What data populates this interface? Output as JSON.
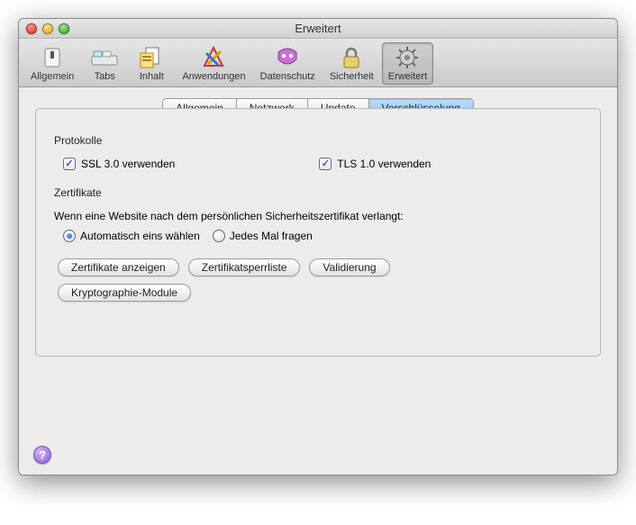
{
  "window": {
    "title": "Erweitert"
  },
  "toolbar": {
    "items": [
      {
        "name": "allgemein",
        "label": "Allgemein",
        "selected": false
      },
      {
        "name": "tabs",
        "label": "Tabs",
        "selected": false
      },
      {
        "name": "inhalt",
        "label": "Inhalt",
        "selected": false
      },
      {
        "name": "anwendungen",
        "label": "Anwendungen",
        "selected": false
      },
      {
        "name": "datenschutz",
        "label": "Datenschutz",
        "selected": false
      },
      {
        "name": "sicherheit",
        "label": "Sicherheit",
        "selected": false
      },
      {
        "name": "erweitert",
        "label": "Erweitert",
        "selected": true
      }
    ]
  },
  "tabs": {
    "items": [
      {
        "label": "Allgemein",
        "active": false
      },
      {
        "label": "Netzwerk",
        "active": false
      },
      {
        "label": "Update",
        "active": false
      },
      {
        "label": "Verschlüsselung",
        "active": true
      }
    ]
  },
  "sections": {
    "protocols": {
      "label": "Protokolle",
      "ssl": {
        "label": "SSL 3.0 verwenden",
        "checked": true
      },
      "tls": {
        "label": "TLS 1.0 verwenden",
        "checked": true
      }
    },
    "certificates": {
      "label": "Zertifikate",
      "desc": "Wenn eine Website nach dem persönlichen Sicherheitszertifikat verlangt:",
      "radio_auto": "Automatisch eins wählen",
      "radio_ask": "Jedes Mal fragen",
      "selected": "auto",
      "buttons": {
        "view": "Zertifikate anzeigen",
        "crl": "Zertifikatsperrliste",
        "validate": "Validierung",
        "crypto": "Kryptographie-Module"
      }
    }
  },
  "help_glyph": "?"
}
